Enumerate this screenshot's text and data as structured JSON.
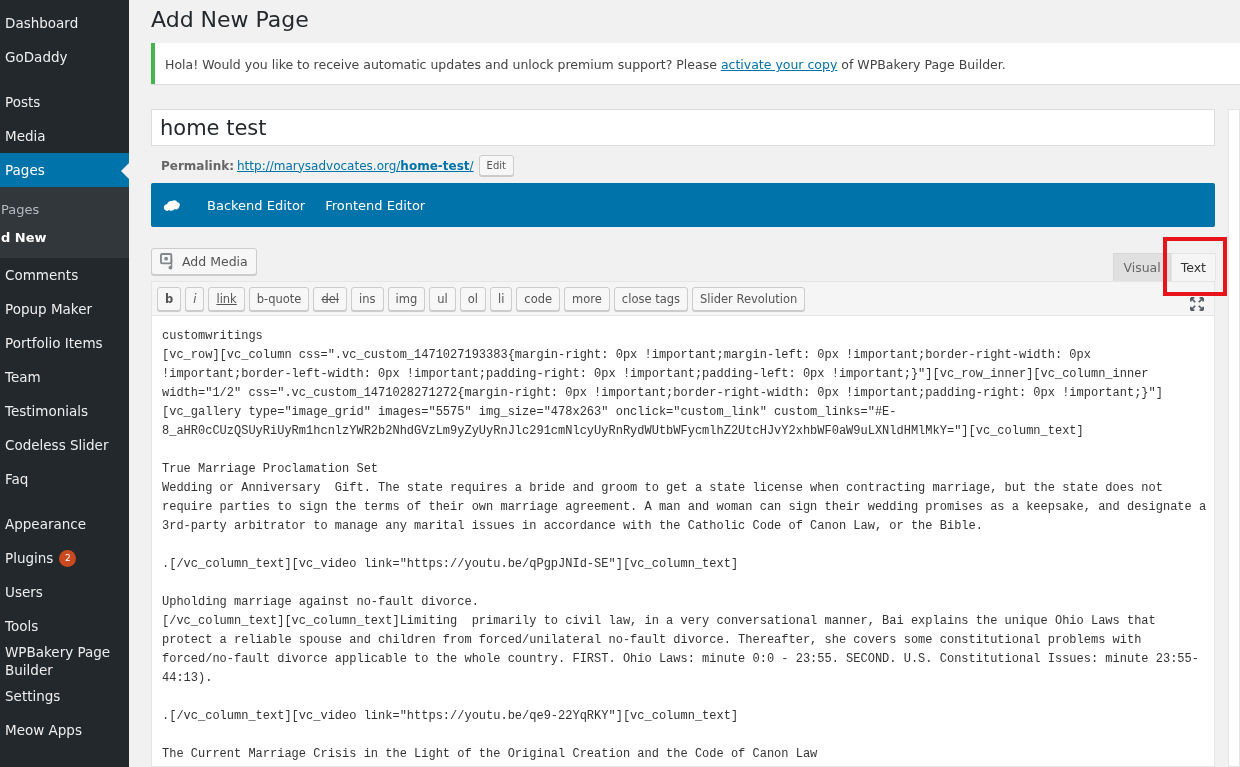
{
  "sidebar": {
    "groups": [
      [
        {
          "label": "Dashboard",
          "selected": false
        },
        {
          "label": "GoDaddy",
          "selected": false
        }
      ],
      [
        {
          "label": "Posts",
          "selected": false
        },
        {
          "label": "Media",
          "selected": false
        },
        {
          "label": "Pages",
          "selected": true,
          "children": [
            {
              "label": "Pages",
              "selected": false
            },
            {
              "label": "d New",
              "selected": true
            }
          ]
        },
        {
          "label": "Comments",
          "selected": false
        },
        {
          "label": "Popup Maker",
          "selected": false
        },
        {
          "label": "Portfolio Items",
          "selected": false
        },
        {
          "label": "Team",
          "selected": false
        },
        {
          "label": "Testimonials",
          "selected": false
        },
        {
          "label": "Codeless Slider",
          "selected": false
        },
        {
          "label": "Faq",
          "selected": false
        }
      ],
      [
        {
          "label": "Appearance",
          "selected": false
        },
        {
          "label": "Plugins",
          "selected": false,
          "badge": "2"
        },
        {
          "label": "Users",
          "selected": false
        },
        {
          "label": "Tools",
          "selected": false
        },
        {
          "label": "WPBakery Page Builder",
          "selected": false
        },
        {
          "label": "Settings",
          "selected": false
        },
        {
          "label": "Meow Apps",
          "selected": false
        }
      ]
    ]
  },
  "page_title": "Add New Page",
  "notice": {
    "before": "Hola! Would you like to receive automatic updates and unlock premium support? Please ",
    "link": "activate your copy",
    "after": " of WPBakery Page Builder."
  },
  "title_field": {
    "value": "home test"
  },
  "permalink": {
    "label": "Permalink:",
    "url_base": "http://marysadvocates.org/",
    "slug": "home-test",
    "url_end": "/",
    "edit_button": "Edit"
  },
  "builder_buttons": [
    "Backend Editor",
    "Frontend Editor"
  ],
  "add_media": "Add Media",
  "editor_tabs": [
    {
      "label": "Visual",
      "selected": false
    },
    {
      "label": "Text",
      "selected": true
    }
  ],
  "toolbar": [
    {
      "label": "b",
      "kind": "bold"
    },
    {
      "label": "i",
      "kind": "italic"
    },
    {
      "label": "link",
      "kind": "underline"
    },
    {
      "label": "b-quote",
      "kind": "plain"
    },
    {
      "label": "del",
      "kind": "strike"
    },
    {
      "label": "ins",
      "kind": "plain"
    },
    {
      "label": "img",
      "kind": "plain"
    },
    {
      "label": "ul",
      "kind": "plain"
    },
    {
      "label": "ol",
      "kind": "plain"
    },
    {
      "label": "li",
      "kind": "plain"
    },
    {
      "label": "code",
      "kind": "plain"
    },
    {
      "label": "more",
      "kind": "plain"
    },
    {
      "label": "close tags",
      "kind": "plain"
    },
    {
      "label": "Slider Revolution",
      "kind": "plain"
    }
  ],
  "editor_blocks": [
    "customwritings\n[vc_row][vc_column css=\".vc_custom_1471027193383{margin-right: 0px !important;margin-left: 0px !important;border-right-width: 0px\n!important;border-left-width: 0px !important;padding-right: 0px !important;padding-left: 0px !important;}\"][vc_row_inner][vc_column_inner\nwidth=\"1/2\" css=\".vc_custom_1471028271272{margin-right: 0px !important;border-right-width: 0px !important;padding-right: 0px !important;}\"]\n[vc_gallery type=\"image_grid\" images=\"5575\" img_size=\"478x263\" onclick=\"custom_link\" custom_links=\"#E-\n8_aHR0cCUzQSUyRiUyRm1hcnlzYWR2b2NhdGVzLm9yZyUyRnJlc291cmNlcyUyRnRydWUtbWFycmlhZ2UtcHJvY2xhbWF0aW9uLXNldHMlMkY=\"][vc_column_text]",
    "True Marriage Proclamation Set\nWedding or Anniversary  Gift. The state requires a bride and groom to get a state license when contracting marriage, but the state does not\nrequire parties to sign the terms of their own marriage agreement. A man and woman can sign their wedding promises as a keepsake, and designate a\n3rd-party arbitrator to manage any marital issues in accordance with the Catholic Code of Canon Law, or the Bible.",
    ".[/vc_column_text][vc_video link=\"https://youtu.be/qPgpJNId-SE\"][vc_column_text]",
    "Upholding marriage against no-fault divorce.\n[/vc_column_text][vc_column_text]Limiting  primarily to civil law, in a very conversational manner, Bai explains the unique Ohio Laws that\nprotect a reliable spouse and children from forced/unilateral no-fault divorce. Thereafter, she covers some constitutional problems with\nforced/no-fault divorce applicable to the whole country. FIRST. Ohio Laws: minute 0:0 - 23:55. SECOND. U.S. Constitutional Issues: minute 23:55-\n44:13).",
    ".[/vc_column_text][vc_video link=\"https://youtu.be/qe9-22YqRKY\"][vc_column_text]",
    "The Current Marriage Crisis in the Light of the Original Creation and the Code of Canon Law"
  ]
}
